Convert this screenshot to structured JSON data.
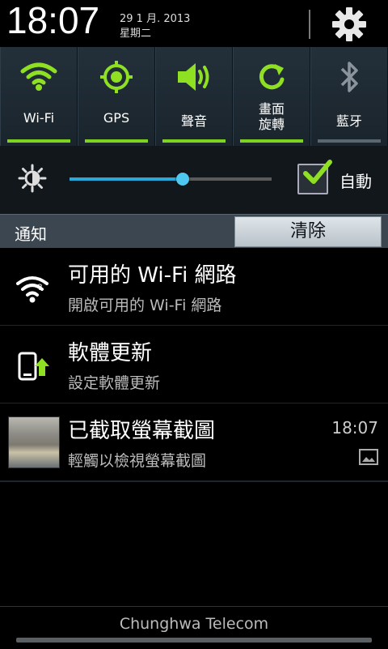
{
  "status": {
    "time": "18:07",
    "date_line1": "29 1 月. 2013",
    "date_line2": "星期二"
  },
  "toggles": [
    {
      "label": "Wi-Fi",
      "icon": "wifi-icon",
      "active": true
    },
    {
      "label": "GPS",
      "icon": "gps-icon",
      "active": true
    },
    {
      "label": "聲音",
      "icon": "sound-icon",
      "active": true
    },
    {
      "label_line1": "畫面",
      "label_line2": "旋轉",
      "icon": "rotate-icon",
      "active": true
    },
    {
      "label": "藍牙",
      "icon": "bluetooth-icon",
      "active": false
    }
  ],
  "brightness": {
    "level": 0.56,
    "auto_label": "自動",
    "auto_checked": true
  },
  "notifications_header": {
    "title": "通知",
    "clear_label": "清除"
  },
  "notifications": [
    {
      "title": "可用的 Wi-Fi 網路",
      "subtitle": "開啟可用的 Wi-Fi 網路",
      "icon": "wifi-notification-icon"
    },
    {
      "title": "軟體更新",
      "subtitle": "設定軟體更新",
      "icon": "software-update-icon"
    },
    {
      "title": "已截取螢幕截圖",
      "subtitle": "輕觸以檢視螢幕截圖",
      "time": "18:07",
      "icon": "screenshot-thumbnail"
    }
  ],
  "carrier": "Chunghwa Telecom",
  "colors": {
    "accent_green": "#7ed320",
    "accent_blue": "#2aa8d8"
  }
}
